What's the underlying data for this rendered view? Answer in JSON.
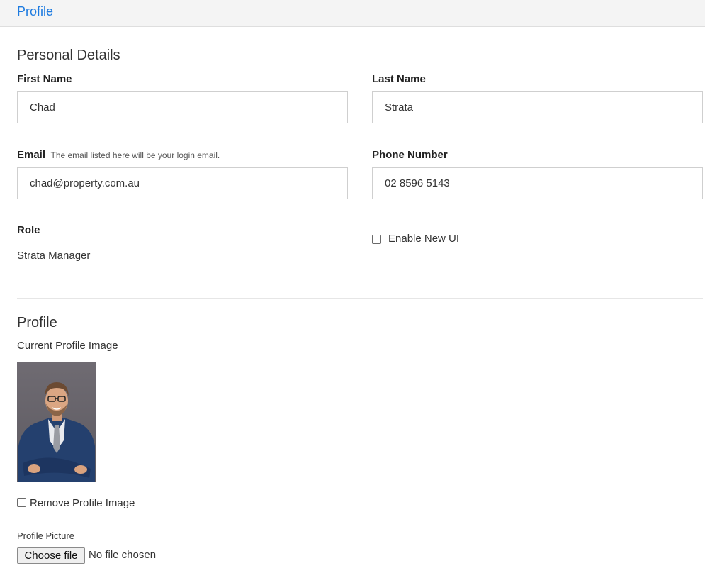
{
  "header": {
    "title": "Profile"
  },
  "personal_details": {
    "title": "Personal Details",
    "first_name": {
      "label": "First Name",
      "value": "Chad"
    },
    "last_name": {
      "label": "Last Name",
      "value": "Strata"
    },
    "email": {
      "label": "Email",
      "help": "The email listed here will be your login email.",
      "value": "chad@property.com.au"
    },
    "phone": {
      "label": "Phone Number",
      "value": "02 8596 5143"
    },
    "role": {
      "label": "Role",
      "value": "Strata Manager"
    },
    "enable_new_ui": {
      "label": "Enable New UI",
      "checked": false
    }
  },
  "profile": {
    "title": "Profile",
    "current_image_label": "Current Profile Image",
    "remove_image": {
      "label": "Remove Profile Image",
      "checked": false
    },
    "picture_label": "Profile Picture",
    "file_button": "Choose file",
    "file_status": "No file chosen"
  },
  "colors": {
    "link": "#1e7be0",
    "header_bg": "#f4f4f4",
    "photo_bg": "#66626a",
    "suit": "#24406e"
  }
}
